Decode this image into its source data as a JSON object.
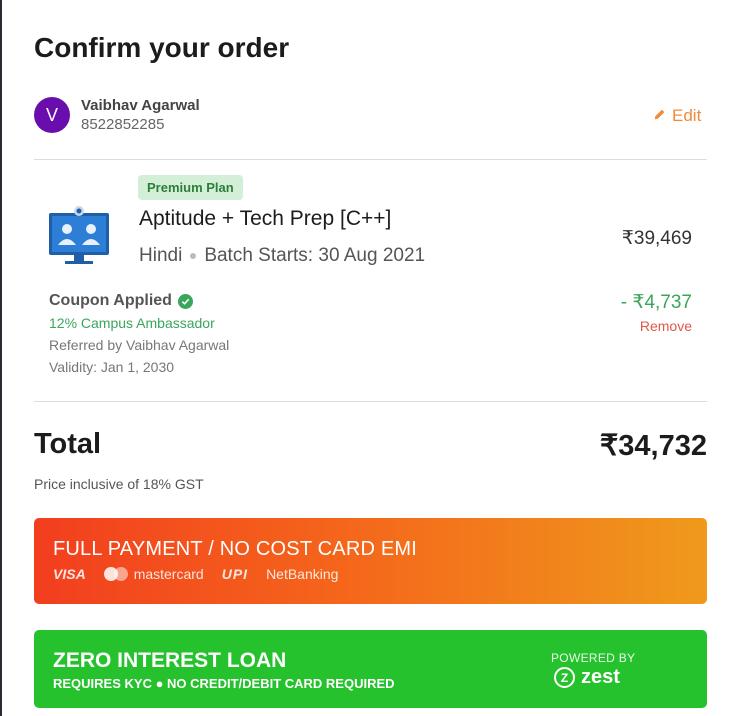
{
  "header": {
    "title": "Confirm your order"
  },
  "user": {
    "avatar_initial": "V",
    "name": "Vaibhav Agarwal",
    "phone": "8522852285",
    "edit_label": "Edit"
  },
  "course": {
    "badge": "Premium Plan",
    "title": "Aptitude + Tech Prep [C++]",
    "language": "Hindi",
    "batch_label": "Batch Starts:",
    "batch_date": "30 Aug 2021",
    "price": "₹39,469"
  },
  "coupon": {
    "title": "Coupon Applied",
    "name": "12% Campus Ambassador",
    "referred_by": "Referred by Vaibhav Agarwal",
    "validity": "Validity: Jan 1, 2030",
    "discount": "- ₹4,737",
    "remove_label": "Remove"
  },
  "total": {
    "label": "Total",
    "value": "₹34,732",
    "note": "Price inclusive of 18% GST"
  },
  "payment_full": {
    "title": "FULL PAYMENT / NO COST CARD EMI",
    "methods": {
      "visa": "VISA",
      "mastercard": "mastercard",
      "upi": "UPI",
      "netbanking": "NetBanking"
    }
  },
  "payment_loan": {
    "title": "ZERO INTEREST LOAN",
    "subtitle": "REQUIRES KYC ● NO CREDIT/DEBIT CARD REQUIRED",
    "powered_by": "POWERED BY",
    "provider": "zest"
  },
  "colors": {
    "accent": "#f08a3c",
    "success": "#3aa65a",
    "danger": "#e0584b",
    "avatar": "#6a0dad",
    "loan_button": "#26c22e"
  }
}
